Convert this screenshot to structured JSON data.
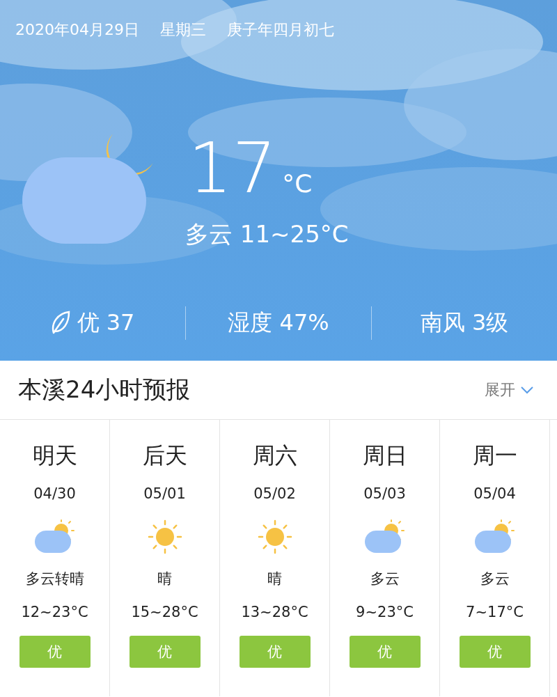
{
  "date_bar": {
    "date": "2020年04月29日",
    "weekday": "星期三",
    "lunar_date": "庚子年四月初七"
  },
  "current": {
    "kind": "cloudy_night",
    "temperature": "17",
    "unit": "°C",
    "condition": "多云 11~25°C"
  },
  "stats": [
    {
      "kind": "air",
      "text": "优 37"
    },
    {
      "kind": "humidity",
      "text": "湿度 47%"
    },
    {
      "kind": "wind",
      "text": "南风 3级"
    }
  ],
  "forecast_header": {
    "title": "本溪24小时预报",
    "toggle": "展开"
  },
  "forecast": [
    {
      "kind": "partly_cloudy",
      "day": "明天",
      "date": "04/30",
      "condition": "多云转晴",
      "temp": "12~23°C",
      "air_quality": "优"
    },
    {
      "kind": "sunny",
      "day": "后天",
      "date": "05/01",
      "condition": "晴",
      "temp": "15~28°C",
      "air_quality": "优"
    },
    {
      "kind": "sunny",
      "day": "周六",
      "date": "05/02",
      "condition": "晴",
      "temp": "13~28°C",
      "air_quality": "优"
    },
    {
      "kind": "partly_cloudy",
      "day": "周日",
      "date": "05/03",
      "condition": "多云",
      "temp": "9~23°C",
      "air_quality": "优"
    },
    {
      "kind": "partly_cloudy",
      "day": "周一",
      "date": "05/04",
      "condition": "多云",
      "temp": "7~17°C",
      "air_quality": "优"
    }
  ]
}
